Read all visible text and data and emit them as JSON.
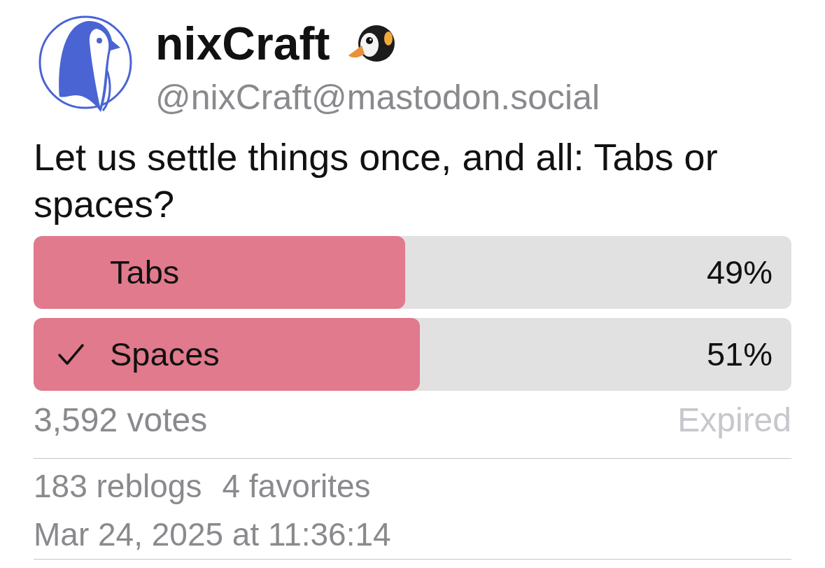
{
  "author": {
    "display_name": "nixCraft",
    "handle": "@nixCraft@mastodon.social"
  },
  "status": {
    "text": "Let us settle things once, and all: Tabs or spaces?"
  },
  "poll": {
    "options": [
      {
        "title": "Tabs",
        "percent": "49%",
        "level": 0.49,
        "selected": false
      },
      {
        "title": "Spaces",
        "percent": "51%",
        "level": 0.51,
        "selected": true
      }
    ],
    "votes": "3,592 votes",
    "state": "Expired"
  },
  "stats": [
    "183 reblogs",
    "4 favorites"
  ],
  "timestamp": "Mar 24, 2025 at 11:36:14"
}
